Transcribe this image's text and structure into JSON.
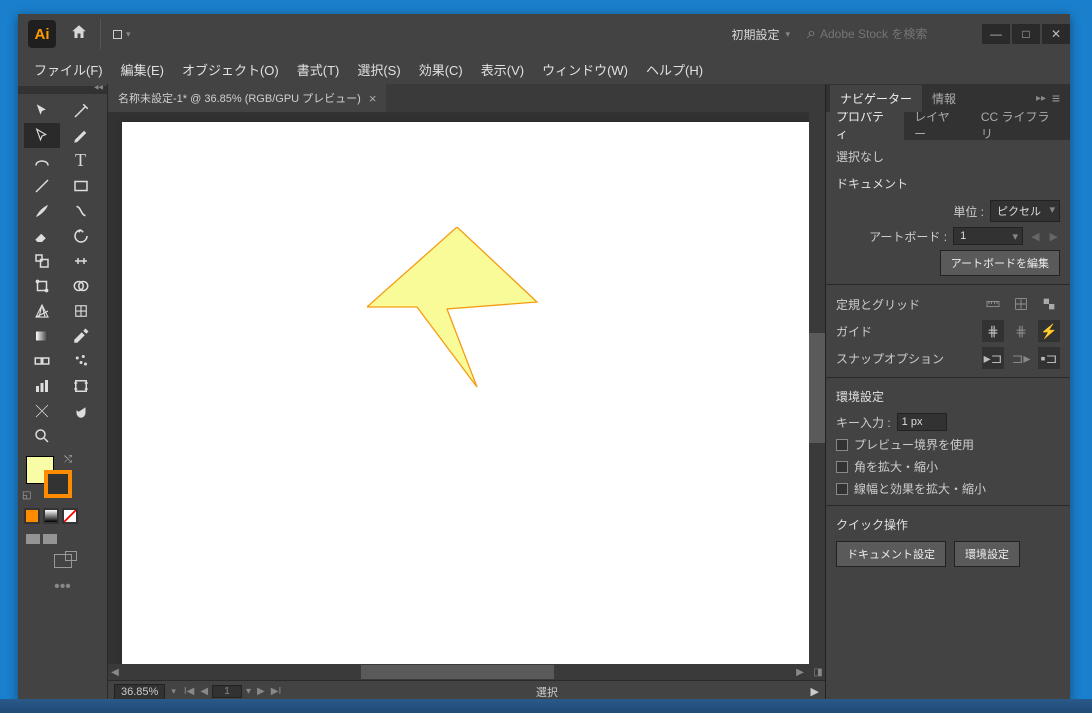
{
  "app": {
    "logo_text": "Ai"
  },
  "titlebar": {
    "workspace": "初期設定",
    "search_placeholder": "Adobe Stock を検索"
  },
  "menubar": {
    "file": "ファイル(F)",
    "edit": "編集(E)",
    "object": "オブジェクト(O)",
    "type": "書式(T)",
    "select": "選択(S)",
    "effect": "効果(C)",
    "view": "表示(V)",
    "window": "ウィンドウ(W)",
    "help": "ヘルプ(H)"
  },
  "document": {
    "tab_title": "名称未設定-1* @ 36.85% (RGB/GPU プレビュー)"
  },
  "statusbar": {
    "zoom": "36.85%",
    "page": "1",
    "selection": "選択"
  },
  "panels": {
    "navigator_tab": "ナビゲーター",
    "info_tab": "情報",
    "properties_tab": "プロパティ",
    "layers_tab": "レイヤー",
    "cclib_tab": "CC ライブラリ"
  },
  "properties": {
    "selection_none": "選択なし",
    "document_section": "ドキュメント",
    "units_label": "単位 :",
    "units_value": "ピクセル",
    "artboard_label": "アートボード :",
    "artboard_value": "1",
    "edit_artboards": "アートボードを編集",
    "rulers_grid": "定規とグリッド",
    "guides": "ガイド",
    "snap_options": "スナップオプション",
    "prefs_section": "環境設定",
    "key_input_label": "キー入力 :",
    "key_input_value": "1 px",
    "chk_preview": "プレビュー境界を使用",
    "chk_scale_corners": "角を拡大・縮小",
    "chk_scale_strokes": "線幅と効果を拡大・縮小",
    "quick_section": "クイック操作",
    "btn_doc_setup": "ドキュメント設定",
    "btn_prefs": "環境設定"
  },
  "colors": {
    "fill": "#f8fca6",
    "stroke": "#ff8c00",
    "shape_fill": "#f9fb99",
    "shape_stroke": "#f39c12"
  }
}
